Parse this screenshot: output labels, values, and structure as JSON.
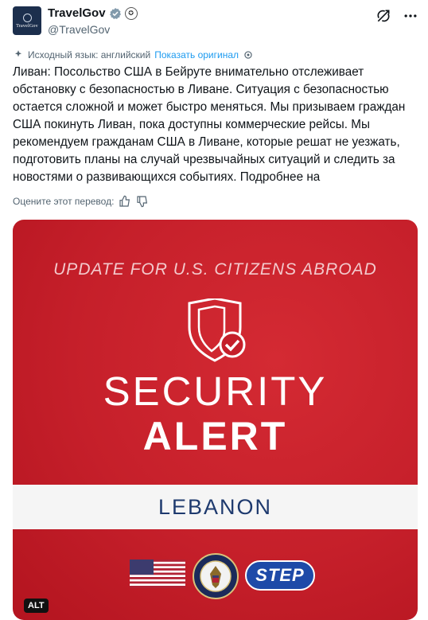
{
  "author": {
    "display_name": "TravelGov",
    "handle": "@TravelGov",
    "avatar_text": "TravelGov",
    "verified_icon": "verified-badge-icon",
    "affiliation_icon": "government-seal-icon"
  },
  "top_actions": {
    "grok_icon": "grok-icon",
    "more_icon": "more-icon"
  },
  "translation": {
    "source_label": "Исходный язык: английский",
    "show_original": "Показать оригинал"
  },
  "tweet": {
    "text": "Ливан: Посольство США в Бейруте внимательно отслеживает обстановку с безопасностью в Ливане. Ситуация с безопасностью остается сложной и может быстро меняться. Мы призываем граждан США покинуть Ливан, пока доступны коммерческие рейсы. Мы рекомендуем гражданам США в Ливане, которые решат не уезжать, подготовить планы на случай чрезвычайных ситуаций и следить за новостями о развивающихся событиях. Подробнее на"
  },
  "rating": {
    "label": "Оцените этот перевод:"
  },
  "media": {
    "heading": "UPDATE FOR U.S. CITIZENS ABROAD",
    "title_line1": "SECURITY",
    "title_line2": "ALERT",
    "country": "LEBANON",
    "step_label": "STEP",
    "alt_badge": "ALT",
    "colors": {
      "background": "#c51f2a",
      "band": "#f5f5f5",
      "country_text": "#1e3a6e",
      "step_bg": "#1e4aa8"
    }
  }
}
